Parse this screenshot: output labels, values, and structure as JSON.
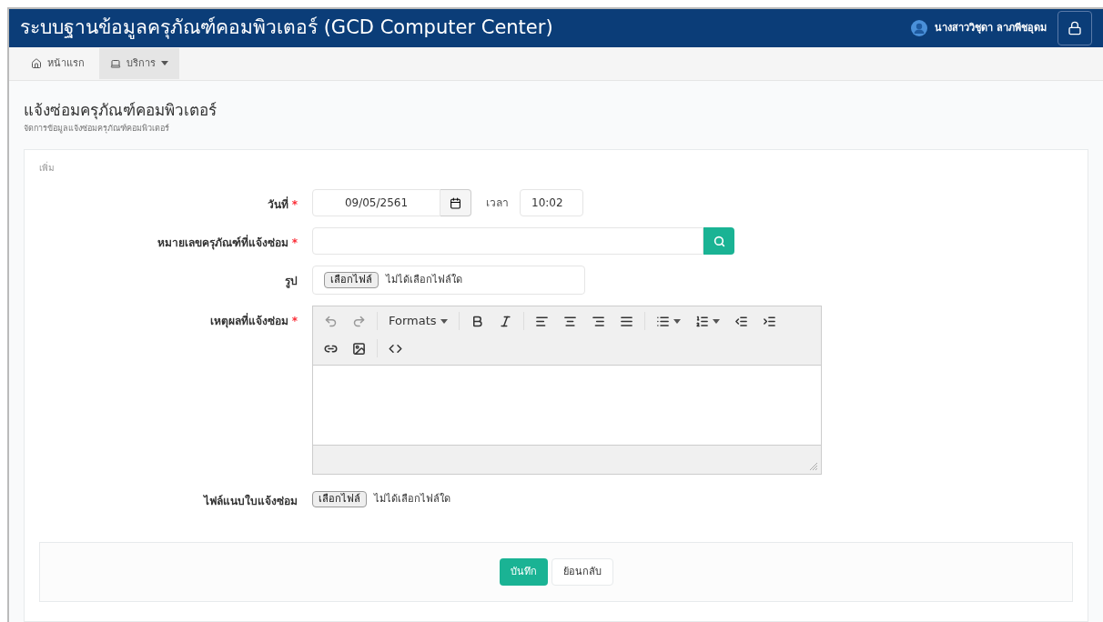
{
  "header": {
    "title": "ระบบฐานข้อมูลครุภัณฑ์คอมพิวเตอร์ (GCD Computer Center)",
    "user": "นางสาววิชุดา ลาภพีชอุดม"
  },
  "nav": [
    {
      "label": "หน้าแรก",
      "dropdown": false,
      "selected": false
    },
    {
      "label": "บริการ",
      "dropdown": true,
      "selected": true
    }
  ],
  "page": {
    "title": "แจ้งซ่อมครุภัณฑ์คอมพิวเตอร์",
    "subtitle": "จัดการข้อมูลแจ้งซ่อมครุภัณฑ์คอมพิวเตอร์"
  },
  "form": {
    "heading": "เพิ่ม",
    "fields": [
      {
        "kind": "date",
        "label": "วันที่",
        "required_mark": "*",
        "value": "09/05/2561",
        "time_label": "เวลา",
        "time_value": "10:02"
      },
      {
        "kind": "search",
        "label": "หมายเลขครุภัณฑ์ที่แจ้งซ่อม",
        "required_mark": "*"
      },
      {
        "kind": "file",
        "label": "รูป",
        "button": "เลือกไฟล์",
        "status": "ไม่ได้เลือกไฟล์ใด"
      },
      {
        "kind": "editor",
        "label": "เหตุผลที่แจ้งซ่อม",
        "required_mark": "*",
        "formats": "Formats"
      },
      {
        "kind": "attachment",
        "label": "ไฟล์แนบใบแจ้งซ่อม",
        "button": "เลือกไฟล์",
        "status": "ไม่ได้เลือกไฟล์ใด"
      }
    ],
    "buttons": [
      {
        "label": "บันทึก",
        "kind": "primary"
      },
      {
        "label": "ย้อนกลับ",
        "kind": "default"
      }
    ]
  }
}
